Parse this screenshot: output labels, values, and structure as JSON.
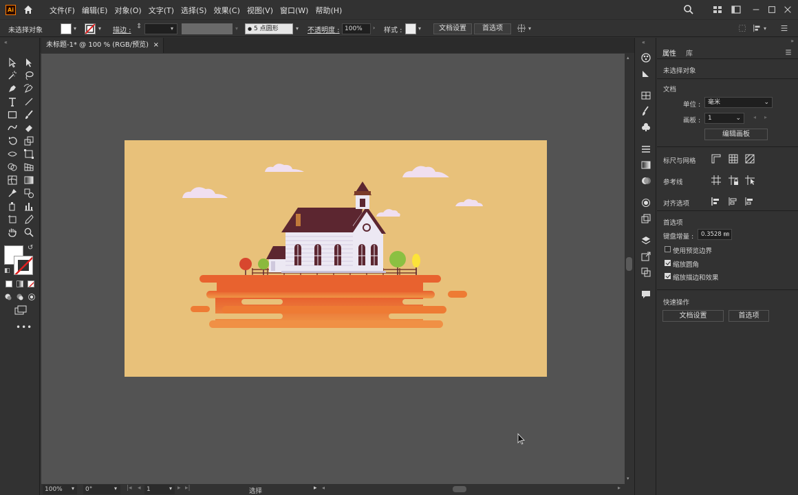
{
  "app": {
    "logo": "Ai"
  },
  "menubar": {
    "items": [
      "文件(F)",
      "编辑(E)",
      "对象(O)",
      "文字(T)",
      "选择(S)",
      "效果(C)",
      "视图(V)",
      "窗口(W)",
      "帮助(H)"
    ]
  },
  "controlbar": {
    "selection_label": "未选择对象",
    "stroke_label": "描边 :",
    "brush_value": "5 点圆形",
    "opacity_label": "不透明度 :",
    "opacity_value": "100%",
    "style_label": "样式 :",
    "doc_setup_button": "文档设置",
    "prefs_button": "首选项"
  },
  "document_tab": {
    "title": "未标题-1* @ 100 % (RGB/预览)",
    "close": "×"
  },
  "statusbar": {
    "zoom": "100%",
    "rotation": "0°",
    "artboard_num": "1",
    "tool_name": "选择"
  },
  "properties_panel": {
    "tab_properties": "属性",
    "tab_library": "库",
    "no_selection": "未选择对象",
    "document_section": "文档",
    "unit_label": "单位 :",
    "unit_value": "毫米",
    "artboard_label": "画板 :",
    "artboard_value": "1",
    "edit_artboard_button": "编辑画板",
    "rulers_grids_label": "标尺与网格",
    "guides_label": "参考线",
    "align_options_label": "对齐选项",
    "preferences_section": "首选项",
    "keyboard_increment_label": "键盘增量 :",
    "keyboard_increment_value": "0.3528 ㎜",
    "preview_bounds": {
      "label": "使用预览边界",
      "checked": false
    },
    "scale_corners": {
      "label": "缩放圆角",
      "checked": true
    },
    "scale_strokes": {
      "label": "缩放描边和效果",
      "checked": true
    },
    "quick_actions_section": "快速操作",
    "doc_setup_button": "文档设置",
    "prefs_button": "首选项"
  },
  "colors": {
    "app_bg": "#323232",
    "canvas_bg": "#535353",
    "artboard_bg": "#e8c17a",
    "island_orange": "#ee7f35",
    "roof": "#5c2630",
    "wall": "#ece8f3",
    "cloud": "#f0dff0"
  }
}
